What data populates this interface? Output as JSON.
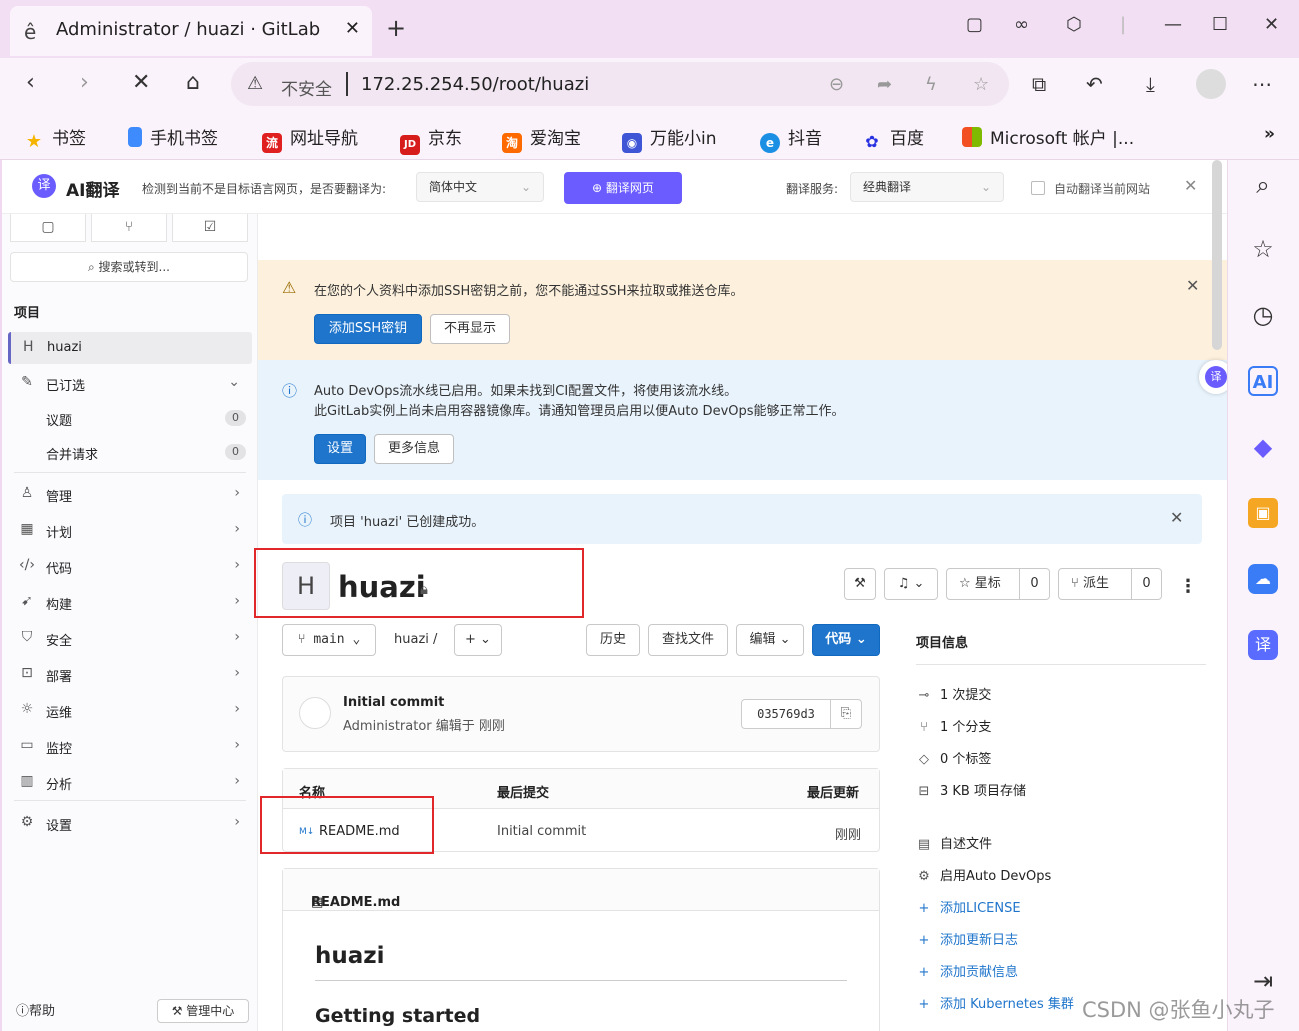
{
  "browser": {
    "tab_title": "Administrator / huazi · GitLab",
    "insecure_label": "不安全",
    "url": "172.25.254.50/root/huazi",
    "bookmarks": [
      {
        "label": "书签",
        "color": "#f5b400",
        "icon": "star-icon"
      },
      {
        "label": "手机书签",
        "color": "#3d8bfd",
        "icon": "phone-icon"
      },
      {
        "label": "网址导航",
        "color": "#e02020",
        "icon": "nav-icon"
      },
      {
        "label": "京东",
        "color": "#d71c1c",
        "icon": "jd-icon"
      },
      {
        "label": "爱淘宝",
        "color": "#ff6a00",
        "icon": "taobao-icon"
      },
      {
        "label": "万能小in",
        "color": "#3e55d6",
        "icon": "robot-icon"
      },
      {
        "label": "抖音",
        "color": "#1a8fe3",
        "icon": "douyin-icon"
      },
      {
        "label": "百度",
        "color": "#2932e1",
        "icon": "baidu-icon"
      },
      {
        "label": "Microsoft 帐户 |...",
        "color": "#f25022",
        "icon": "microsoft-icon"
      }
    ],
    "more_label": "»"
  },
  "translate": {
    "brand": "AI翻译",
    "message": "检测到当前不是目标语言网页，是否要翻译为:",
    "target_lang": "简体中文",
    "translate_btn": "翻译网页",
    "service_label": "翻译服务:",
    "service": "经典翻译",
    "auto_label": "自动翻译当前网站"
  },
  "sidebar": {
    "search": "搜索或转到...",
    "section": "项目",
    "project_initial": "H",
    "project_name": "huazi",
    "pinned": "已订选",
    "issues": "议题",
    "issues_count": "0",
    "mrs": "合并请求",
    "mrs_count": "0",
    "menu": [
      "管理",
      "计划",
      "代码",
      "构建",
      "安全",
      "部署",
      "运维",
      "监控",
      "分析"
    ],
    "settings": "设置",
    "help": "帮助",
    "admin": "管理中心"
  },
  "alerts": {
    "ssh_message": "在您的个人资料中添加SSH密钥之前，您不能通过SSH来拉取或推送仓库。",
    "ssh_add": "添加SSH密钥",
    "ssh_dismiss": "不再显示",
    "devops_line1": "Auto DevOps流水线已启用。如果未找到CI配置文件，将使用该流水线。",
    "devops_line2": "此GitLab实例上尚未启用容器镜像库。请通知管理员启用以便Auto DevOps能够正常工作。",
    "devops_settings": "设置",
    "devops_more": "更多信息",
    "created_message": "项目 'huazi' 已创建成功。"
  },
  "project": {
    "initial": "H",
    "name": "huazi",
    "star_label": "星标",
    "star_count": "0",
    "fork_label": "派生",
    "fork_count": "0"
  },
  "repo": {
    "branch": "main",
    "path": "huazi",
    "path_sep": "/",
    "history": "历史",
    "find_file": "查找文件",
    "edit": "编辑",
    "code": "代码",
    "commit_title": "Initial commit",
    "commit_meta": "Administrator 编辑于 刚刚",
    "commit_sha": "035769d3",
    "col_name": "名称",
    "col_last_commit": "最后提交",
    "col_last_update": "最后更新",
    "files": [
      {
        "name": "README.md",
        "commit": "Initial commit",
        "updated": "刚刚"
      }
    ],
    "readme_file": "README.md",
    "readme_h1": "huazi",
    "readme_h2": "Getting started"
  },
  "info": {
    "title": "项目信息",
    "stats": [
      "1 次提交",
      "1 个分支",
      "0 个标签",
      "3 KB 项目存储"
    ],
    "actions": [
      "自述文件",
      "启用Auto DevOps"
    ],
    "links": [
      "添加LICENSE",
      "添加更新日志",
      "添加贡献信息",
      "添加 Kubernetes 集群"
    ]
  },
  "watermark": "CSDN @张鱼小丸子"
}
